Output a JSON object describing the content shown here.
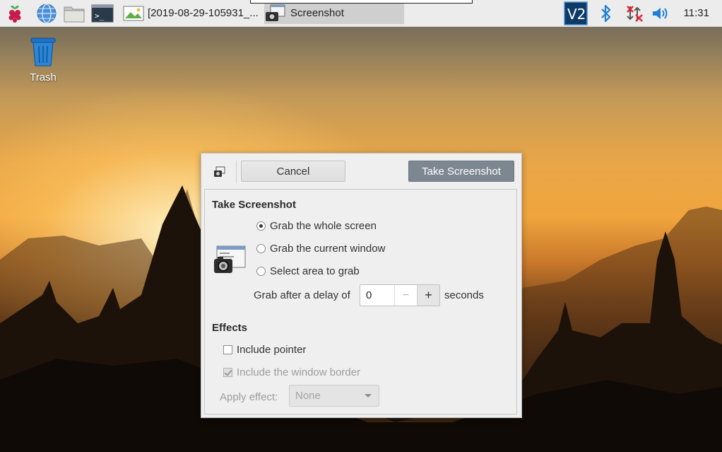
{
  "taskbar": {
    "launchers": [
      {
        "name": "raspberry-menu-icon"
      },
      {
        "name": "web-browser-icon"
      },
      {
        "name": "file-manager-icon"
      },
      {
        "name": "terminal-icon"
      }
    ],
    "tasks": [
      {
        "label": "[2019-08-29-105931_...",
        "icon": "image-viewer-icon",
        "active": false
      },
      {
        "label": "Screenshot",
        "icon": "screenshot-app-icon",
        "active": true
      }
    ],
    "tray": [
      "vnc-icon",
      "bluetooth-icon",
      "network-disconnected-icon",
      "volume-icon"
    ],
    "clock": "11:31"
  },
  "desktop": {
    "icons": [
      {
        "label": "Trash",
        "icon": "trash-icon"
      }
    ]
  },
  "dialog": {
    "cancel_label": "Cancel",
    "take_label": "Take Screenshot",
    "take_section_title": "Take Screenshot",
    "options": [
      {
        "label": "Grab the whole screen",
        "checked": true
      },
      {
        "label": "Grab the current window",
        "checked": false
      },
      {
        "label": "Select area to grab",
        "checked": false
      }
    ],
    "delay_label": "Grab after a delay of",
    "delay_value": "0",
    "minus_symbol": "−",
    "plus_symbol": "+",
    "seconds_label": "seconds",
    "effects_title": "Effects",
    "include_pointer_label": "Include pointer",
    "include_pointer_checked": false,
    "include_border_label": "Include the window border",
    "include_border_checked": true,
    "apply_effect_label": "Apply effect:",
    "apply_effect_value": "None"
  },
  "colors": {
    "take_button_bg": "#7d8792",
    "bluetooth": "#1e7fd6",
    "network_x": "#e0283a",
    "vnc_bg": "#0d3a66"
  }
}
